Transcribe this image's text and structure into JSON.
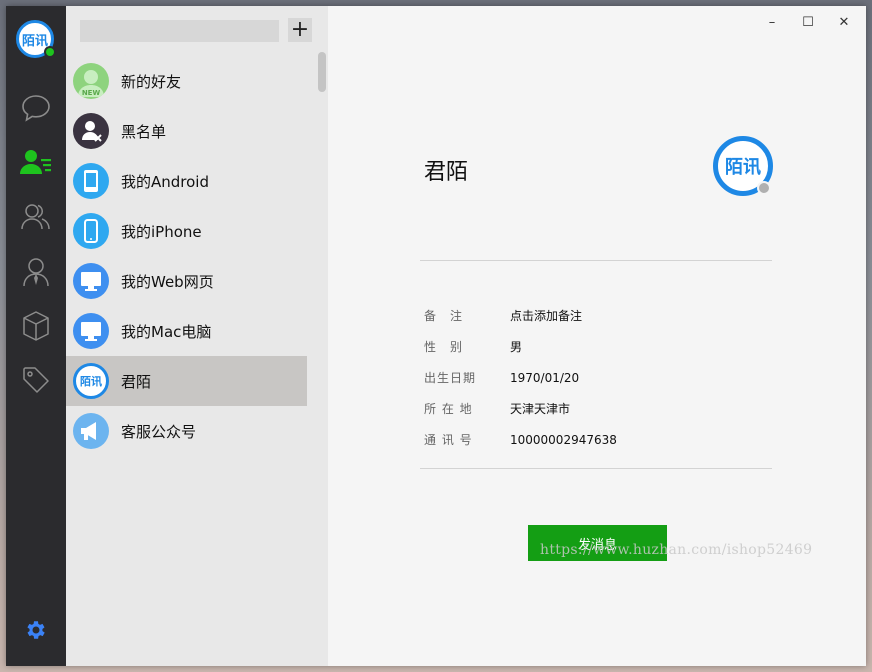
{
  "app": {
    "logo_text": "陌讯"
  },
  "rail": {
    "items": [
      {
        "icon": "chat-bubble-icon",
        "active": false
      },
      {
        "icon": "contacts-icon",
        "active": true
      },
      {
        "icon": "group-icon",
        "active": false
      },
      {
        "icon": "person-icon",
        "active": false
      },
      {
        "icon": "cube-icon",
        "active": false
      },
      {
        "icon": "tag-icon",
        "active": false
      }
    ],
    "settings_icon": "gear-icon",
    "accent": "#1ec31e",
    "settings_color": "#3b82f6"
  },
  "search": {
    "value": "",
    "placeholder": ""
  },
  "add_button": "+",
  "contacts": [
    {
      "name": "新的好友",
      "icon": "new-friend-icon",
      "color": "#7ecb6f"
    },
    {
      "name": "黑名单",
      "icon": "blacklist-icon",
      "color": "#3a3340"
    },
    {
      "name": "我的Android",
      "icon": "phone-icon",
      "color": "#2fa8f0"
    },
    {
      "name": "我的iPhone",
      "icon": "iphone-icon",
      "color": "#2fa8f0"
    },
    {
      "name": "我的Web网页",
      "icon": "monitor-icon",
      "color": "#3e8ff0"
    },
    {
      "name": "我的Mac电脑",
      "icon": "monitor-icon",
      "color": "#3e8ff0"
    },
    {
      "name": "君陌",
      "icon": "moxun-avatar-icon",
      "color": "#1e88e5",
      "selected": true
    },
    {
      "name": "客服公众号",
      "icon": "megaphone-icon",
      "color": "#6cb4ef"
    }
  ],
  "window_controls": {
    "minimize": "–",
    "maximize": "☐",
    "close": "✕"
  },
  "profile": {
    "name": "君陌",
    "avatar_text": "陌讯",
    "fields": [
      {
        "label": "备　注",
        "value": "点击添加备注"
      },
      {
        "label": "性　别",
        "value": "男"
      },
      {
        "label": "出生日期",
        "value": "1970/01/20"
      },
      {
        "label": "所 在 地",
        "value": "天津天津市"
      },
      {
        "label": "通 讯 号",
        "value": "10000002947638"
      }
    ],
    "send_button": "发消息"
  },
  "watermark": "https://www.huzhan.com/ishop52469"
}
